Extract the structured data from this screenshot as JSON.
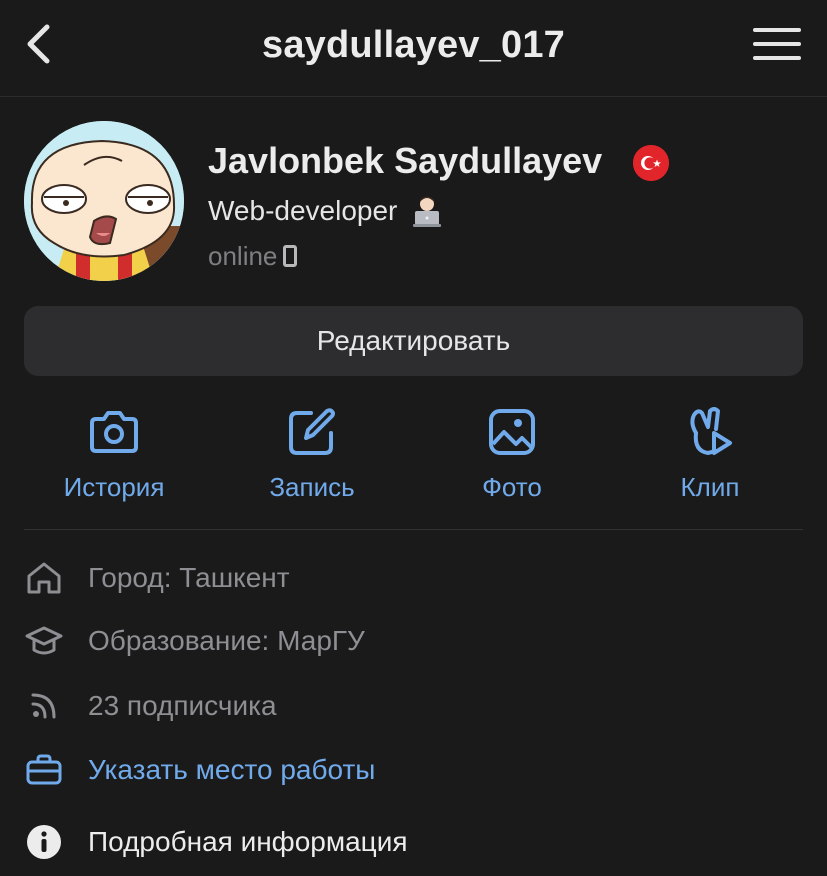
{
  "header": {
    "title": "saydullayev_017",
    "back_icon": "chevron-left-icon",
    "menu_icon": "hamburger-menu-icon"
  },
  "profile": {
    "name": "Javlonbek Saydullayev",
    "flag": "turkey-flag-icon",
    "bio": "Web-developer",
    "bio_emoji": "technologist-emoji",
    "status": "online",
    "status_icon": "mobile-phone-icon"
  },
  "edit_button": {
    "label": "Редактировать"
  },
  "actions": [
    {
      "label": "История",
      "icon": "camera-icon"
    },
    {
      "label": "Запись",
      "icon": "compose-icon"
    },
    {
      "label": "Фото",
      "icon": "photo-icon"
    },
    {
      "label": "Клип",
      "icon": "clip-icon"
    }
  ],
  "info": {
    "city": "Город: Ташкент",
    "education": "Образование: МарГУ",
    "followers": "23 подписчика",
    "work": "Указать место работы",
    "details": "Подробная информация"
  },
  "colors": {
    "background": "#1a1a1b",
    "accent": "#71aaeb",
    "button": "#2d2d2f",
    "muted_text": "#8e8e93"
  }
}
